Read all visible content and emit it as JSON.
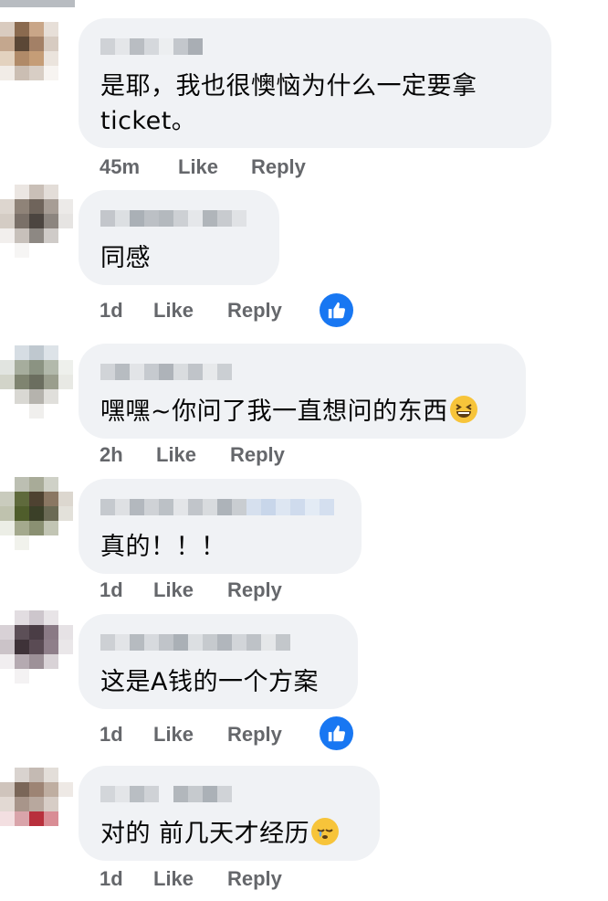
{
  "colors": {
    "bubble": "#f0f2f5",
    "meta": "#65676b",
    "text": "#050505",
    "reaction": "#1877f2",
    "emoji": "#f7c43a"
  },
  "comments": [
    {
      "text_lines": [
        "是耶，我也很懊恼为什么一定要拿",
        "ticket。"
      ],
      "time": "45m",
      "like": "Like",
      "reply": "Reply",
      "has_reaction": false
    },
    {
      "text": "同感",
      "time": "1d",
      "like": "Like",
      "reply": "Reply",
      "has_reaction": true,
      "reaction_icon": "thumbs-up-icon"
    },
    {
      "text": "嘿嘿~你问了我一直想问的东西",
      "emoji": "grinning-squinting-face-icon",
      "time": "2h",
      "like": "Like",
      "reply": "Reply",
      "has_reaction": false
    },
    {
      "text": "真的！！！",
      "time": "1d",
      "like": "Like",
      "reply": "Reply",
      "has_reaction": false
    },
    {
      "text": "这是A钱的一个方案",
      "time": "1d",
      "like": "Like",
      "reply": "Reply",
      "has_reaction": true,
      "reaction_icon": "thumbs-up-icon"
    },
    {
      "text": "对的 前几天才经历",
      "emoji": "sleepy-face-icon",
      "time": "1d",
      "like": "Like",
      "reply": "Reply",
      "has_reaction": false
    }
  ]
}
